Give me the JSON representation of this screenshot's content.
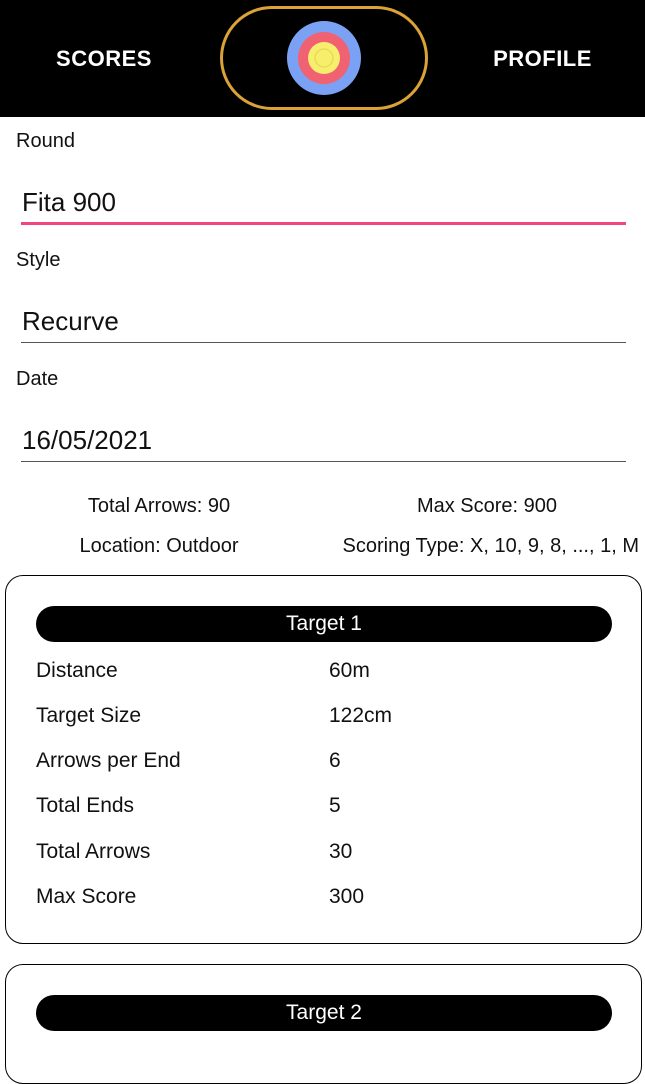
{
  "nav": {
    "scores_label": "SCORES",
    "profile_label": "PROFILE",
    "home_icon": "archery-target-icon",
    "pill_border_color": "#dba236"
  },
  "form": {
    "round": {
      "label": "Round",
      "value": "Fita 900"
    },
    "style": {
      "label": "Style",
      "value": "Recurve"
    },
    "date": {
      "label": "Date",
      "value": "16/05/2021"
    }
  },
  "summary": {
    "total_arrows": "Total Arrows: 90",
    "max_score": "Max Score: 900",
    "location": "Location: Outdoor",
    "scoring_type": "Scoring Type: X, 10, 9, 8, ..., 1, M"
  },
  "targets": [
    {
      "title": "Target 1",
      "rows": [
        {
          "label": "Distance",
          "value": "60m"
        },
        {
          "label": "Target Size",
          "value": "122cm"
        },
        {
          "label": "Arrows per End",
          "value": "6"
        },
        {
          "label": "Total Ends",
          "value": "5"
        },
        {
          "label": "Total Arrows",
          "value": "30"
        },
        {
          "label": "Max Score",
          "value": "300"
        }
      ]
    },
    {
      "title": "Target 2"
    }
  ],
  "colors": {
    "accent_underline": "#f0457f",
    "target_blue": "#7aa1f4",
    "target_red": "#f06272",
    "target_yellow": "#f7ee6e"
  }
}
